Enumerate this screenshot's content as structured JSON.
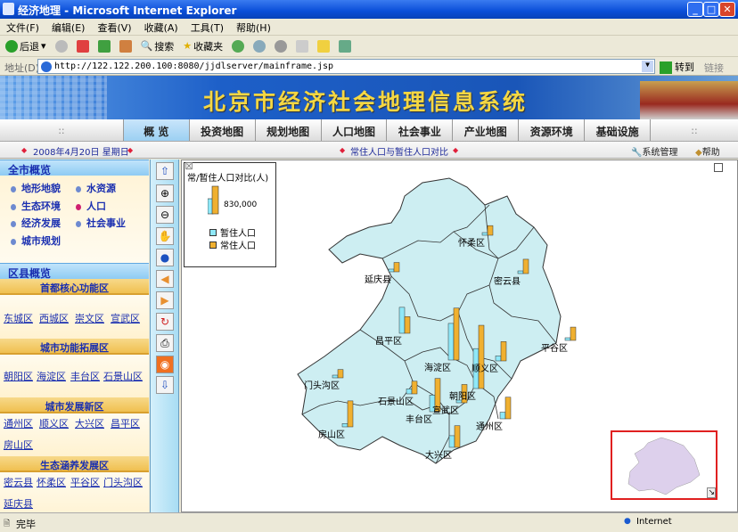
{
  "window": {
    "title": "经济地理 - Microsoft Internet Explorer"
  },
  "menu": [
    "文件(F)",
    "编辑(E)",
    "查看(V)",
    "收藏(A)",
    "工具(T)",
    "帮助(H)"
  ],
  "toolbar": {
    "back": "后退",
    "search": "搜索",
    "favorites": "收藏夹"
  },
  "address": {
    "label": "地址(D)",
    "url": "http://122.122.200.100:8080/jjdlserver/mainframe.jsp",
    "go": "转到",
    "links": "链接"
  },
  "banner": {
    "title": "北京市经济社会地理信息系统"
  },
  "nav": {
    "items": [
      "概 览",
      "投资地图",
      "规划地图",
      "人口地图",
      "社会事业",
      "产业地图",
      "资源环境",
      "基础设施"
    ],
    "active": 0,
    "spacer": "::"
  },
  "subbar": {
    "date": "2008年4月20日 星期日",
    "topic": "常住人口与暂住人口对比",
    "admin": "系统管理",
    "help": "帮助"
  },
  "left": {
    "city_header": "全市概览",
    "city_items": [
      "地形地貌",
      "水资源",
      "生态环境",
      "人口",
      "经济发展",
      "社会事业",
      "城市规划"
    ],
    "district_header": "区县概览",
    "sections": [
      {
        "title": "首都核心功能区",
        "links": [
          "东城区",
          "西城区",
          "崇文区",
          "宣武区"
        ]
      },
      {
        "title": "城市功能拓展区",
        "links": [
          "朝阳区",
          "海淀区",
          "丰台区",
          "石景山区"
        ]
      },
      {
        "title": "城市发展新区",
        "links": [
          "通州区",
          "顺义区",
          "大兴区",
          "昌平区",
          "房山区"
        ]
      },
      {
        "title": "生态涵养发展区",
        "links": [
          "密云县",
          "怀柔区",
          "平谷区",
          "门头沟区",
          "延庆县"
        ]
      }
    ]
  },
  "legend": {
    "title": "常/暂住人口对比(人)",
    "scale_value": "830,000",
    "series": [
      "暂住人口",
      "常住人口"
    ],
    "colors": [
      "#8fe8f8",
      "#f0b030"
    ]
  },
  "chart_data": {
    "type": "bar",
    "title": "常/暂住人口对比(人)",
    "reference": 830000,
    "series": [
      {
        "name": "暂住人口"
      },
      {
        "name": "常住人口"
      }
    ],
    "districts": [
      {
        "name": "延庆县",
        "temp": 50000,
        "perm": 280000
      },
      {
        "name": "怀柔区",
        "temp": 60000,
        "perm": 290000
      },
      {
        "name": "密云县",
        "temp": 50000,
        "perm": 430000
      },
      {
        "name": "昌平区",
        "temp": 780000,
        "perm": 500000
      },
      {
        "name": "平谷区",
        "temp": 30000,
        "perm": 400000
      },
      {
        "name": "顺义区",
        "temp": 150000,
        "perm": 580000
      },
      {
        "name": "海淀区",
        "temp": 1100000,
        "perm": 1560000
      },
      {
        "name": "门头沟区",
        "temp": 20000,
        "perm": 250000
      },
      {
        "name": "朝阳区",
        "temp": 1200000,
        "perm": 1900000
      },
      {
        "name": "石景山区",
        "temp": 150000,
        "perm": 380000
      },
      {
        "name": "宣武区",
        "temp": 80000,
        "perm": 550000
      },
      {
        "name": "丰台区",
        "temp": 500000,
        "perm": 1000000
      },
      {
        "name": "通州区",
        "temp": 200000,
        "perm": 650000
      },
      {
        "name": "房山区",
        "temp": 100000,
        "perm": 780000
      },
      {
        "name": "大兴区",
        "temp": 350000,
        "perm": 650000
      }
    ]
  },
  "status": {
    "text": "完毕",
    "zone": "Internet"
  }
}
